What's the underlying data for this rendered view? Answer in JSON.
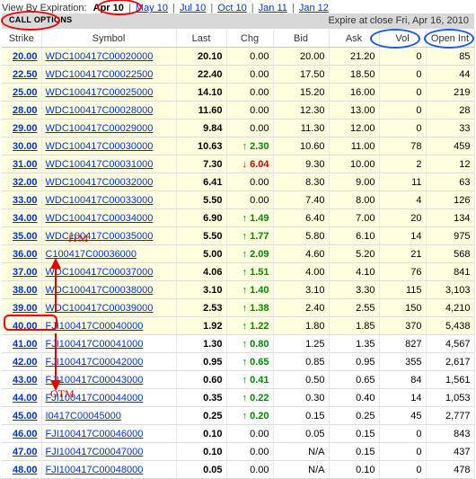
{
  "expiration": {
    "label": "View By Expiration:",
    "active": "Apr 10",
    "others": [
      "May 10",
      "Jul 10",
      "Oct 10",
      "Jan 11",
      "Jan 12"
    ]
  },
  "section": {
    "title": "CALL OPTIONS",
    "expire_text": "Expire at close Fri, Apr 16, 2010"
  },
  "columns": [
    "Strike",
    "Symbol",
    "Last",
    "Chg",
    "Bid",
    "Ask",
    "Vol",
    "Open Int"
  ],
  "rows": [
    {
      "strike": "20.00",
      "symbol": "WDC100417C00020000",
      "last": "20.10",
      "chg": "0.00",
      "dir": "flat",
      "bid": "20.00",
      "ask": "21.20",
      "vol": "0",
      "oi": "85",
      "itm": true
    },
    {
      "strike": "22.50",
      "symbol": "WDC100417C00022500",
      "last": "22.40",
      "chg": "0.00",
      "dir": "flat",
      "bid": "17.50",
      "ask": "18.50",
      "vol": "0",
      "oi": "44",
      "itm": true
    },
    {
      "strike": "25.00",
      "symbol": "WDC100417C00025000",
      "last": "14.10",
      "chg": "0.00",
      "dir": "flat",
      "bid": "15.20",
      "ask": "16.00",
      "vol": "0",
      "oi": "219",
      "itm": true
    },
    {
      "strike": "28.00",
      "symbol": "WDC100417C00028000",
      "last": "11.60",
      "chg": "0.00",
      "dir": "flat",
      "bid": "12.30",
      "ask": "13.00",
      "vol": "0",
      "oi": "28",
      "itm": true
    },
    {
      "strike": "29.00",
      "symbol": "WDC100417C00029000",
      "last": "9.84",
      "chg": "0.00",
      "dir": "flat",
      "bid": "11.30",
      "ask": "12.00",
      "vol": "0",
      "oi": "33",
      "itm": true
    },
    {
      "strike": "30.00",
      "symbol": "WDC100417C00030000",
      "last": "10.63",
      "chg": "2.30",
      "dir": "up",
      "bid": "10.60",
      "ask": "11.00",
      "vol": "78",
      "oi": "459",
      "itm": true
    },
    {
      "strike": "31.00",
      "symbol": "WDC100417C00031000",
      "last": "7.30",
      "chg": "6.04",
      "dir": "down",
      "bid": "9.30",
      "ask": "10.00",
      "vol": "2",
      "oi": "12",
      "itm": true
    },
    {
      "strike": "32.00",
      "symbol": "WDC100417C00032000",
      "last": "6.41",
      "chg": "0.00",
      "dir": "flat",
      "bid": "8.30",
      "ask": "9.00",
      "vol": "11",
      "oi": "63",
      "itm": true
    },
    {
      "strike": "33.00",
      "symbol": "WDC100417C00033000",
      "last": "5.50",
      "chg": "0.00",
      "dir": "flat",
      "bid": "7.40",
      "ask": "8.00",
      "vol": "4",
      "oi": "126",
      "itm": true
    },
    {
      "strike": "34.00",
      "symbol": "WDC100417C00034000",
      "last": "6.90",
      "chg": "1.49",
      "dir": "up",
      "bid": "6.40",
      "ask": "7.00",
      "vol": "20",
      "oi": "134",
      "itm": true
    },
    {
      "strike": "35.00",
      "symbol": "WDC100417C00035000",
      "last": "5.50",
      "chg": "1.77",
      "dir": "up",
      "bid": "5.80",
      "ask": "6.10",
      "vol": "14",
      "oi": "975",
      "itm": true
    },
    {
      "strike": "36.00",
      "symbol": "C100417C00036000",
      "last": "5.00",
      "chg": "2.09",
      "dir": "up",
      "bid": "4.60",
      "ask": "5.20",
      "vol": "21",
      "oi": "568",
      "itm": true
    },
    {
      "strike": "37.00",
      "symbol": "WDC100417C00037000",
      "last": "4.06",
      "chg": "1.51",
      "dir": "up",
      "bid": "4.00",
      "ask": "4.10",
      "vol": "76",
      "oi": "841",
      "itm": true
    },
    {
      "strike": "38.00",
      "symbol": "WDC100417C00038000",
      "last": "3.10",
      "chg": "1.40",
      "dir": "up",
      "bid": "3.10",
      "ask": "3.30",
      "vol": "115",
      "oi": "3,103",
      "itm": true
    },
    {
      "strike": "39.00",
      "symbol": "WDC100417C00039000",
      "last": "2.53",
      "chg": "1.38",
      "dir": "up",
      "bid": "2.40",
      "ask": "2.55",
      "vol": "150",
      "oi": "4,210",
      "itm": true
    },
    {
      "strike": "40.00",
      "symbol": "FJI100417C00040000",
      "last": "1.92",
      "chg": "1.22",
      "dir": "up",
      "bid": "1.80",
      "ask": "1.85",
      "vol": "370",
      "oi": "5,438",
      "itm": true
    },
    {
      "strike": "41.00",
      "symbol": "FJI100417C00041000",
      "last": "1.30",
      "chg": "0.80",
      "dir": "up",
      "bid": "1.25",
      "ask": "1.35",
      "vol": "827",
      "oi": "4,567",
      "itm": false
    },
    {
      "strike": "42.00",
      "symbol": "FJI100417C00042000",
      "last": "0.95",
      "chg": "0.65",
      "dir": "up",
      "bid": "0.85",
      "ask": "0.95",
      "vol": "355",
      "oi": "2,617",
      "itm": false
    },
    {
      "strike": "43.00",
      "symbol": "FJI100417C00043000",
      "last": "0.60",
      "chg": "0.41",
      "dir": "up",
      "bid": "0.50",
      "ask": "0.65",
      "vol": "84",
      "oi": "1,561",
      "itm": false
    },
    {
      "strike": "44.00",
      "symbol": "FJI100417C00044000",
      "last": "0.35",
      "chg": "0.22",
      "dir": "up",
      "bid": "0.30",
      "ask": "0.40",
      "vol": "14",
      "oi": "1,053",
      "itm": false
    },
    {
      "strike": "45.00",
      "symbol": "I0417C00045000",
      "last": "0.25",
      "chg": "0.20",
      "dir": "up",
      "bid": "0.15",
      "ask": "0.25",
      "vol": "45",
      "oi": "2,777",
      "itm": false
    },
    {
      "strike": "46.00",
      "symbol": "FJI100417C00046000",
      "last": "0.10",
      "chg": "0.00",
      "dir": "flat",
      "bid": "0.05",
      "ask": "0.15",
      "vol": "0",
      "oi": "843",
      "itm": false
    },
    {
      "strike": "47.00",
      "symbol": "FJI100417C00047000",
      "last": "0.10",
      "chg": "0.00",
      "dir": "flat",
      "bid": "N/A",
      "ask": "0.15",
      "vol": "0",
      "oi": "437",
      "itm": false
    },
    {
      "strike": "48.00",
      "symbol": "FJI100417C00048000",
      "last": "0.05",
      "chg": "0.00",
      "dir": "flat",
      "bid": "N/A",
      "ask": "0.10",
      "vol": "0",
      "oi": "478",
      "itm": false
    }
  ],
  "annotations": {
    "itm_label": "ITM",
    "otm_label": "OTM"
  },
  "colors": {
    "itm_bg": "#ffffe0",
    "up": "#008800",
    "down": "#cc0000",
    "annotation_red": "#e00000",
    "annotation_blue": "#1a5adb",
    "link": "#0033cc"
  },
  "icons": {
    "up": "arrow-up-icon",
    "down": "arrow-down-icon"
  }
}
